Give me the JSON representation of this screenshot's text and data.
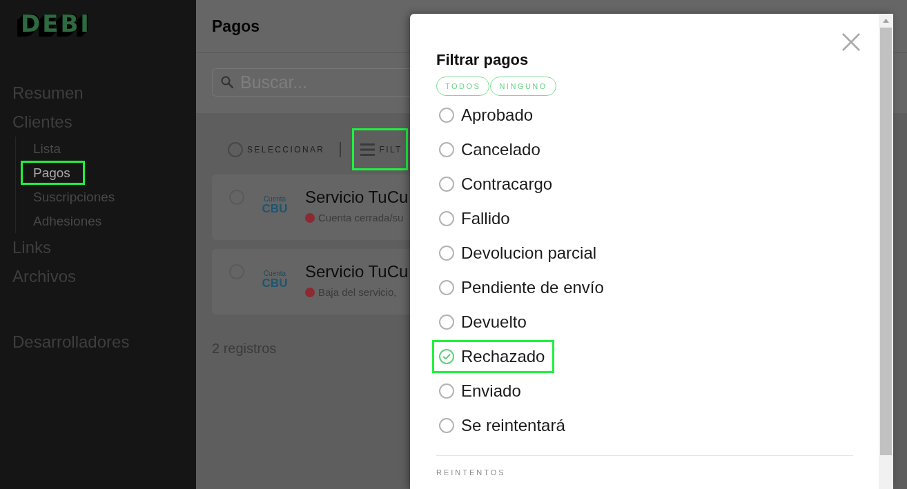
{
  "sidebar": {
    "logo": "DEBI",
    "groups": [
      {
        "items": [
          {
            "label": "Resumen",
            "selected": false
          },
          {
            "label": "Clientes",
            "selected": false,
            "children": [
              {
                "label": "Lista",
                "selected": false,
                "highlighted": false
              },
              {
                "label": "Pagos",
                "selected": true,
                "highlighted": true
              },
              {
                "label": "Suscripciones",
                "selected": false,
                "highlighted": false
              },
              {
                "label": "Adhesiones",
                "selected": false,
                "highlighted": false
              }
            ]
          },
          {
            "label": "Links",
            "selected": false
          },
          {
            "label": "Archivos",
            "selected": false
          }
        ]
      },
      {
        "items": [
          {
            "label": "Desarrolladores",
            "selected": false
          }
        ]
      }
    ]
  },
  "page": {
    "title": "Pagos",
    "search": {
      "placeholder": "Buscar..."
    },
    "toolbar": {
      "select_all": {
        "label": "SELECCIONAR",
        "checked": false
      },
      "filter_button": {
        "label": "FILT",
        "highlighted": true
      }
    },
    "payments": [
      {
        "selected": false,
        "method": {
          "caption": "Cuenta",
          "name": "CBU"
        },
        "title": "Servicio TuCu",
        "color": "#8c2a33",
        "status_text": "Cuenta cerrada/su"
      },
      {
        "selected": false,
        "method": {
          "caption": "Cuenta",
          "name": "CBU"
        },
        "title": "Servicio TuCu",
        "color": "#8c2a33",
        "status_text": "Baja del servicio,"
      }
    ],
    "count": "2 registros"
  },
  "filter_dialog": {
    "title": "Filtrar pagos",
    "quick_buttons": [
      "TODOS",
      "NINGUNO"
    ],
    "options": [
      {
        "label": "Aprobado",
        "checked": false,
        "highlighted": false
      },
      {
        "label": "Cancelado",
        "checked": false,
        "highlighted": false
      },
      {
        "label": "Contracargo",
        "checked": false,
        "highlighted": false
      },
      {
        "label": "Fallido",
        "checked": false,
        "highlighted": false
      },
      {
        "label": "Devolucion parcial",
        "checked": false,
        "highlighted": false
      },
      {
        "label": "Pendiente de envío",
        "checked": false,
        "highlighted": false
      },
      {
        "label": "Devuelto",
        "checked": false,
        "highlighted": false
      },
      {
        "label": "Rechazado",
        "checked": true,
        "highlighted": true
      },
      {
        "label": "Enviado",
        "checked": false,
        "highlighted": false
      },
      {
        "label": "Se reintentará",
        "checked": false,
        "highlighted": false
      }
    ],
    "section_label": "REINTENTOS"
  }
}
